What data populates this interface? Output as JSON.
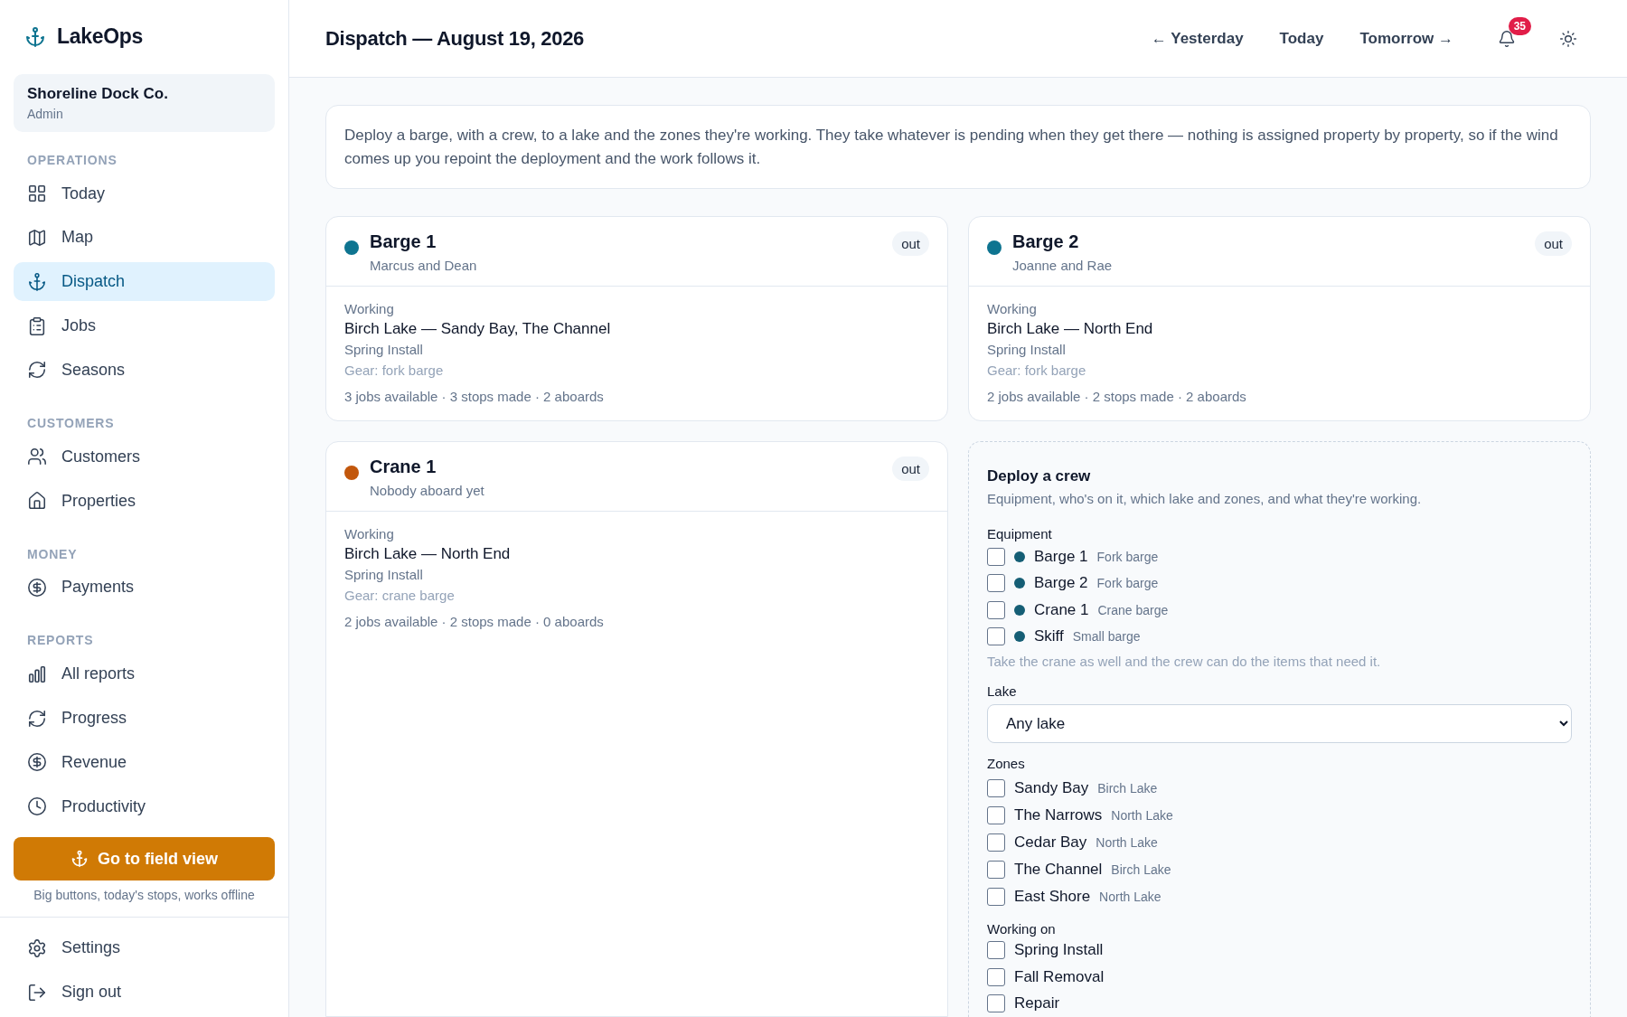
{
  "app": {
    "name": "LakeOps"
  },
  "org": {
    "name": "Shoreline Dock Co.",
    "role": "Admin"
  },
  "sidebar": {
    "sections": [
      {
        "heading": "OPERATIONS",
        "items": [
          {
            "label": "Today",
            "selected": false
          },
          {
            "label": "Map",
            "selected": false
          },
          {
            "label": "Dispatch",
            "selected": true
          },
          {
            "label": "Jobs",
            "selected": false
          },
          {
            "label": "Seasons",
            "selected": false
          }
        ]
      },
      {
        "heading": "CUSTOMERS",
        "items": [
          {
            "label": "Customers",
            "selected": false
          },
          {
            "label": "Properties",
            "selected": false
          }
        ]
      },
      {
        "heading": "MONEY",
        "items": [
          {
            "label": "Payments",
            "selected": false
          }
        ]
      },
      {
        "heading": "REPORTS",
        "items": [
          {
            "label": "All reports",
            "selected": false
          },
          {
            "label": "Progress",
            "selected": false
          },
          {
            "label": "Revenue",
            "selected": false
          },
          {
            "label": "Productivity",
            "selected": false
          }
        ]
      }
    ]
  },
  "field_view": {
    "label": "Go to field view",
    "caption": "Big buttons, today's stops, works offline"
  },
  "footer_items": [
    {
      "label": "Settings"
    },
    {
      "label": "Sign out"
    }
  ],
  "header": {
    "title": "Dispatch — August 19, 2026",
    "nav": [
      "← Yesterday",
      "Today",
      "Tomorrow →"
    ],
    "notification_count": "35"
  },
  "intro": "Deploy a barge, with a crew, to a lake and the zones they're working. They take whatever is pending when they get there — nothing is assigned property by property, so if the wind comes up you repoint the deployment and the work follows it.",
  "deployments": [
    {
      "name": "Barge 1",
      "crew": "Marcus and Dean",
      "status": "out",
      "color": "#0e7490",
      "working_label": "Working",
      "location": "Birch Lake — Sandy Bay, The Channel",
      "job_type": "Spring Install",
      "gear": "Gear: fork barge",
      "stats": "3 jobs available · 3 stops made · 2 aboards"
    },
    {
      "name": "Barge 2",
      "crew": "Joanne and Rae",
      "status": "out",
      "color": "#0e7490",
      "working_label": "Working",
      "location": "Birch Lake — North End",
      "job_type": "Spring Install",
      "gear": "Gear: fork barge",
      "stats": "2 jobs available · 2 stops made · 2 aboards"
    },
    {
      "name": "Crane 1",
      "crew": "Nobody aboard yet",
      "status": "out",
      "color": "#c2570c",
      "working_label": "Working",
      "location": "Birch Lake — North End",
      "job_type": "Spring Install",
      "gear": "Gear: crane barge",
      "stats": "2 jobs available · 2 stops made · 0 aboards"
    }
  ],
  "deploy_form": {
    "title": "Deploy a crew",
    "subtitle": "Equipment, who's on it, which lake and zones, and what they're working.",
    "equipment": {
      "label": "Equipment",
      "items": [
        {
          "name": "Barge 1",
          "type": "Fork barge",
          "checked": false,
          "color": "#155e75"
        },
        {
          "name": "Barge 2",
          "type": "Fork barge",
          "checked": false,
          "color": "#155e75"
        },
        {
          "name": "Crane 1",
          "type": "Crane barge",
          "checked": false,
          "color": "#155e75"
        },
        {
          "name": "Skiff",
          "type": "Small barge",
          "checked": false,
          "color": "#155e75"
        }
      ],
      "hint": "Take the crane as well and the crew can do the items that need it."
    },
    "lake": {
      "label": "Lake",
      "value": "Any lake"
    },
    "zones": {
      "label": "Zones",
      "items": [
        {
          "name": "Sandy Bay",
          "lake": "Birch Lake",
          "checked": false
        },
        {
          "name": "The Narrows",
          "lake": "North Lake",
          "checked": false
        },
        {
          "name": "Cedar Bay",
          "lake": "North Lake",
          "checked": false
        },
        {
          "name": "The Channel",
          "lake": "Birch Lake",
          "checked": false
        },
        {
          "name": "East Shore",
          "lake": "North Lake",
          "checked": false
        }
      ]
    },
    "working_on": {
      "label": "Working on",
      "items": [
        {
          "label": "Spring Install",
          "checked": false
        },
        {
          "label": "Fall Removal",
          "checked": false
        },
        {
          "label": "Repair",
          "checked": false
        }
      ]
    }
  }
}
